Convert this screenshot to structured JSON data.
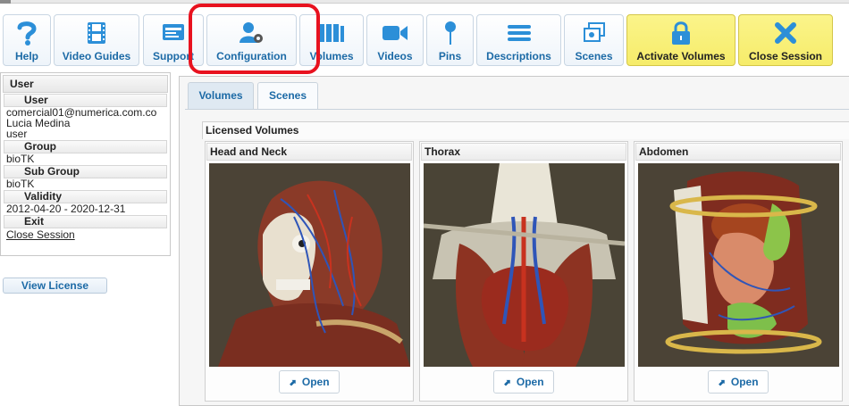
{
  "toolbar": {
    "buttons": [
      {
        "label": "Help",
        "icon": "help-icon"
      },
      {
        "label": "Video Guides",
        "icon": "film-icon"
      },
      {
        "label": "Support",
        "icon": "support-icon"
      },
      {
        "label": "Configuration",
        "icon": "user-gear-icon"
      },
      {
        "label": "Volumes",
        "icon": "books-icon"
      },
      {
        "label": "Videos",
        "icon": "video-camera-icon"
      },
      {
        "label": "Pins",
        "icon": "pin-icon"
      },
      {
        "label": "Descriptions",
        "icon": "list-icon"
      },
      {
        "label": "Scenes",
        "icon": "scenes-icon"
      },
      {
        "label": "Activate Volumes",
        "icon": "lock-icon"
      },
      {
        "label": "Close Session",
        "icon": "close-icon"
      }
    ]
  },
  "user_panel": {
    "header": "User",
    "user_label": "User",
    "email": "comercial01@numerica.com.co",
    "name": "Lucia Medina",
    "role": "user",
    "group_label": "Group",
    "group": "bioTK",
    "subgroup_label": "Sub Group",
    "subgroup": "bioTK",
    "validity_label": "Validity",
    "validity": "2012-04-20 - 2020-12-31",
    "exit_label": "Exit",
    "close_session": "Close Session",
    "view_license": "View License"
  },
  "main": {
    "tabs": [
      {
        "label": "Volumes",
        "active": true
      },
      {
        "label": "Scenes",
        "active": false
      }
    ],
    "section_title": "Licensed Volumes",
    "volumes": [
      {
        "title": "Head and Neck",
        "open_label": "Open"
      },
      {
        "title": "Thorax",
        "open_label": "Open"
      },
      {
        "title": "Abdomen",
        "open_label": "Open"
      }
    ]
  },
  "colors": {
    "accent": "#1c6aa6",
    "highlight": "#e8121f",
    "activate_bg": "#f8ef72"
  }
}
